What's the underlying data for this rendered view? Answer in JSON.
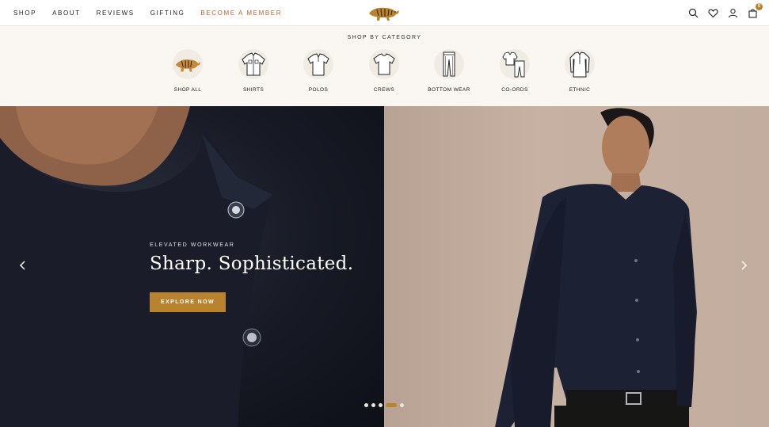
{
  "nav": {
    "links": [
      {
        "label": "SHOP"
      },
      {
        "label": "ABOUT"
      },
      {
        "label": "REVIEWS"
      },
      {
        "label": "GIFTING"
      },
      {
        "label": "BECOME A MEMBER"
      }
    ],
    "logo_icon": "tiger-logo-icon",
    "cart_count": "0",
    "accent_color": "#c0612b"
  },
  "categories": {
    "heading": "SHOP BY CATEGORY",
    "items": [
      {
        "label": "SHOP ALL",
        "icon": "tiger-icon"
      },
      {
        "label": "SHIRTS",
        "icon": "shirt-icon"
      },
      {
        "label": "POLOS",
        "icon": "polo-icon"
      },
      {
        "label": "CREWS",
        "icon": "tshirt-icon"
      },
      {
        "label": "BOTTOM WEAR",
        "icon": "trousers-icon"
      },
      {
        "label": "CO-ORDS",
        "icon": "coord-set-icon"
      },
      {
        "label": "ETHNIC",
        "icon": "kurta-icon"
      }
    ]
  },
  "hero": {
    "eyebrow": "ELEVATED WORKWEAR",
    "headline": "Sharp. Sophisticated.",
    "cta_label": "EXPLORE NOW",
    "brand_color": "#b8822f",
    "slide_count": 5,
    "active_slide": 4
  }
}
